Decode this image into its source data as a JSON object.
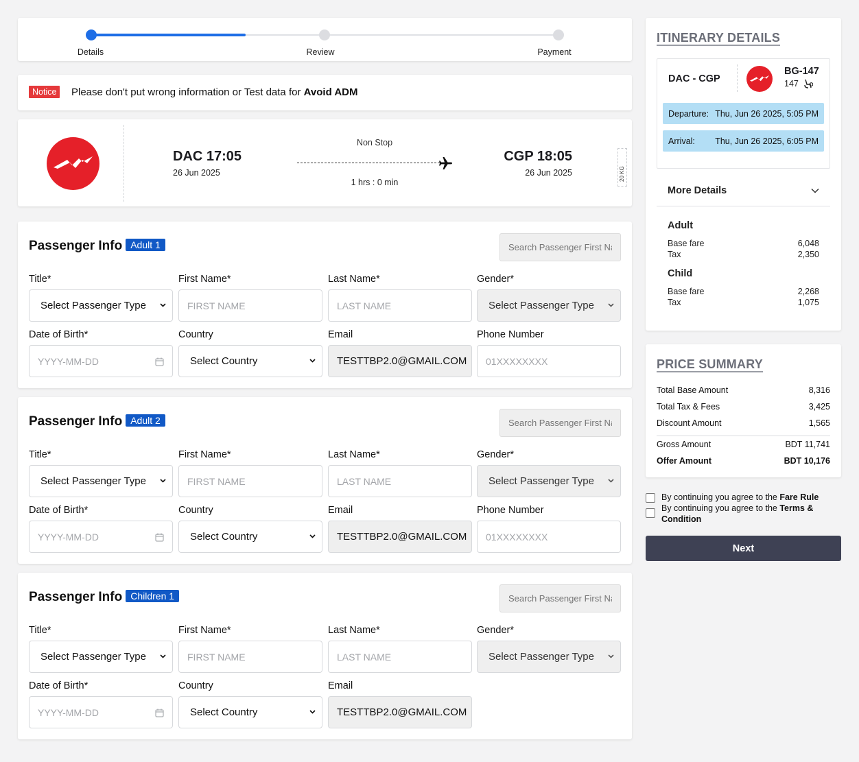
{
  "stepper": {
    "steps": [
      {
        "label": "Details",
        "active": true
      },
      {
        "label": "Review",
        "active": false
      },
      {
        "label": "Payment",
        "active": false
      }
    ],
    "progress_percent": 33
  },
  "notice": {
    "badge": "Notice",
    "text": "Please don't put wrong information or Test data for ",
    "highlight": "Avoid ADM"
  },
  "flight": {
    "departure": {
      "code_time": "DAC 17:05",
      "date": "26 Jun 2025"
    },
    "arrival": {
      "code_time": "CGP 18:05",
      "date": "26 Jun 2025"
    },
    "stops": "Non Stop",
    "duration": "1 hrs : 0 min",
    "baggage": "20 KG",
    "airline_brand_color": "#e52029"
  },
  "passengers": [
    {
      "heading": "Passenger Info",
      "badge": "Adult 1",
      "search_placeholder": "Search Passenger First Name",
      "labels": {
        "title": "Title*",
        "first_name": "First Name*",
        "last_name": "Last Name*",
        "gender": "Gender*",
        "dob": "Date of Birth*",
        "country": "Country",
        "email": "Email",
        "phone": "Phone Number"
      },
      "title_value": "Select Passenger Type",
      "first_name_placeholder": "FIRST NAME",
      "last_name_placeholder": "LAST NAME",
      "gender_value": "Select Passenger Type",
      "dob_placeholder": "YYYY-MM-DD",
      "country_value": "Select Country",
      "email_value": "TESTTBP2.0@GMAIL.COM",
      "phone_placeholder": "01XXXXXXXX"
    },
    {
      "heading": "Passenger Info",
      "badge": "Adult 2",
      "search_placeholder": "Search Passenger First Name",
      "labels": {
        "title": "Title*",
        "first_name": "First Name*",
        "last_name": "Last Name*",
        "gender": "Gender*",
        "dob": "Date of Birth*",
        "country": "Country",
        "email": "Email",
        "phone": "Phone Number"
      },
      "title_value": "Select Passenger Type",
      "first_name_placeholder": "FIRST NAME",
      "last_name_placeholder": "LAST NAME",
      "gender_value": "Select Passenger Type",
      "dob_placeholder": "YYYY-MM-DD",
      "country_value": "Select Country",
      "email_value": "TESTTBP2.0@GMAIL.COM",
      "phone_placeholder": "01XXXXXXXX"
    },
    {
      "heading": "Passenger Info",
      "badge": "Children 1",
      "search_placeholder": "Search Passenger First Name",
      "labels": {
        "title": "Title*",
        "first_name": "First Name*",
        "last_name": "Last Name*",
        "gender": "Gender*",
        "dob": "Date of Birth*",
        "country": "Country",
        "email": "Email"
      },
      "title_value": "Select Passenger Type",
      "first_name_placeholder": "FIRST NAME",
      "last_name_placeholder": "LAST NAME",
      "gender_value": "Select Passenger Type",
      "dob_placeholder": "YYYY-MM-DD",
      "country_value": "Select Country",
      "email_value": "TESTTBP2.0@GMAIL.COM"
    }
  ],
  "itinerary": {
    "heading": "ITINERARY DETAILS",
    "route": "DAC - CGP",
    "flight_no": "BG-147",
    "flight_sub": "147",
    "departure_label": "Departure:",
    "departure_value": "Thu, Jun 26 2025, 5:05 PM",
    "arrival_label": "Arrival:",
    "arrival_value": "Thu, Jun 26 2025, 6:05 PM",
    "highlight_color": "#b3def5",
    "more_details": "More Details",
    "fares": [
      {
        "group": "Adult",
        "rows": [
          {
            "label": "Base fare",
            "value": "6,048"
          },
          {
            "label": "Tax",
            "value": "2,350"
          }
        ]
      },
      {
        "group": "Child",
        "rows": [
          {
            "label": "Base fare",
            "value": "2,268"
          },
          {
            "label": "Tax",
            "value": "1,075"
          }
        ]
      }
    ]
  },
  "price_summary": {
    "heading": "PRICE SUMMARY",
    "rows": [
      {
        "label": "Total Base Amount",
        "value": "8,316"
      },
      {
        "label": "Total Tax & Fees",
        "value": "3,425"
      },
      {
        "label": "Discount Amount",
        "value": "1,565"
      }
    ],
    "gross": {
      "label": "Gross Amount",
      "value": "BDT 11,741"
    },
    "offer": {
      "label": "Offer Amount",
      "value": "BDT 10,176"
    }
  },
  "agreements": {
    "fare_rule_prefix": "By continuing you agree to the ",
    "fare_rule_link": "Fare Rule",
    "terms_prefix": "By continuing you agree to the ",
    "terms_link": "Terms & Condition"
  },
  "next_button": "Next",
  "colors": {
    "primary_blue": "#1e6ee6",
    "badge_blue": "#1159c6",
    "notice_red": "#e5393b",
    "button_dark": "#3e4154"
  }
}
